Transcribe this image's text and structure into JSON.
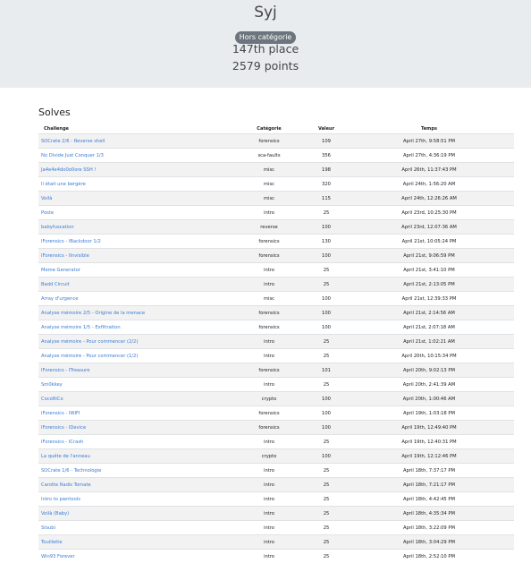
{
  "profile": {
    "username": "Syj",
    "badge": "Hors catégorie",
    "place": "147th place",
    "points": "2579 points"
  },
  "solves": {
    "title": "Solves",
    "columns": [
      "Challenge",
      "Catégorie",
      "Valeur",
      "Temps"
    ],
    "rows": [
      [
        "SOCrate 2/6 - Reverse shell",
        "forensics",
        "109",
        "April 27th, 9:58:51 PM"
      ],
      [
        "No Divide Just Conquer 1/3",
        "sca-faults",
        "356",
        "April 27th, 4:36:19 PM"
      ],
      [
        "Ja4e4e4do0o0ore SSH !",
        "misc",
        "198",
        "April 26th, 11:37:43 PM"
      ],
      [
        "Il était une bergère",
        "misc",
        "320",
        "April 24th, 1:56:20 AM"
      ],
      [
        "Voilà",
        "misc",
        "115",
        "April 24th, 12:26:26 AM"
      ],
      [
        "Poste",
        "intro",
        "25",
        "April 23rd, 10:25:30 PM"
      ],
      [
        "babyfuscation",
        "reverse",
        "100",
        "April 23rd, 12:07:36 AM"
      ],
      [
        "IForensics - IBackdoor 1/2",
        "forensics",
        "130",
        "April 21st, 10:05:24 PM"
      ],
      [
        "IForensics - IInvisible",
        "forensics",
        "100",
        "April 21st, 9:06:59 PM"
      ],
      [
        "Meme Generator",
        "intro",
        "25",
        "April 21st, 3:41:10 PM"
      ],
      [
        "Badd Circuit",
        "intro",
        "25",
        "April 21st, 2:13:05 PM"
      ],
      [
        "Array d'urgence",
        "misc",
        "100",
        "April 21st, 12:39:33 PM"
      ],
      [
        "Analyse mémoire 2/5 - Origine de la menace",
        "forensics",
        "100",
        "April 21st, 2:14:56 AM"
      ],
      [
        "Analyse mémoire 1/5 - Exfiltration",
        "forensics",
        "100",
        "April 21st, 2:07:18 AM"
      ],
      [
        "Analyse mémoire - Pour commencer (2/2)",
        "intro",
        "25",
        "April 21st, 1:02:21 AM"
      ],
      [
        "Analyse mémoire - Pour commencer (1/2)",
        "intro",
        "25",
        "April 20th, 10:15:34 PM"
      ],
      [
        "IForensics - ITreasure",
        "forensics",
        "101",
        "April 20th, 9:02:13 PM"
      ],
      [
        "Sm0kkey",
        "intro",
        "25",
        "April 20th, 2:41:39 AM"
      ],
      [
        "CocoRiCo",
        "crypto",
        "100",
        "April 20th, 1:00:46 AM"
      ],
      [
        "IForensics - IWIFI",
        "forensics",
        "100",
        "April 19th, 1:03:18 PM"
      ],
      [
        "IForensics - IDevice",
        "forensics",
        "100",
        "April 19th, 12:49:40 PM"
      ],
      [
        "IForensics - ICrash",
        "intro",
        "25",
        "April 19th, 12:40:31 PM"
      ],
      [
        "La quête de l'anneau",
        "crypto",
        "100",
        "April 19th, 12:12:46 PM"
      ],
      [
        "SOCrate 1/6 - Technologie",
        "intro",
        "25",
        "April 18th, 7:37:17 PM"
      ],
      [
        "Carotte Radis Tomate",
        "intro",
        "25",
        "April 18th, 7:21:17 PM"
      ],
      [
        "Intro to pwntools",
        "intro",
        "25",
        "April 18th, 4:42:45 PM"
      ],
      [
        "Voilà (Baby)",
        "intro",
        "25",
        "April 18th, 4:35:34 PM"
      ],
      [
        "Sloubi",
        "intro",
        "25",
        "April 18th, 3:22:09 PM"
      ],
      [
        "Touillette",
        "intro",
        "25",
        "April 18th, 3:04:29 PM"
      ],
      [
        "Win93 Forever",
        "intro",
        "25",
        "April 18th, 2:52:10 PM"
      ]
    ]
  }
}
